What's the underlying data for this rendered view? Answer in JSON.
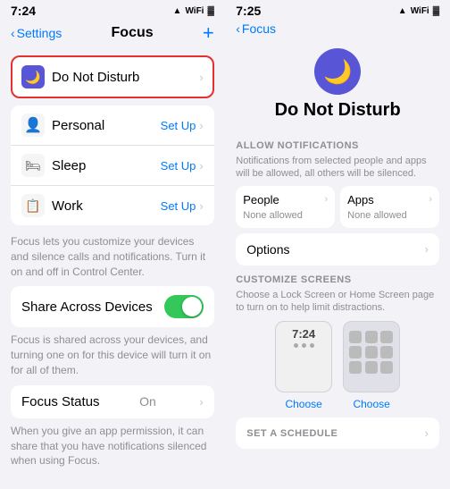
{
  "left": {
    "statusBar": {
      "time": "7:24",
      "icons": "● ▲ ▓"
    },
    "nav": {
      "back": "Settings",
      "title": "Focus",
      "add": "+"
    },
    "doNotDisturb": {
      "label": "Do Not Disturb"
    },
    "items": [
      {
        "id": "personal",
        "icon": "👤",
        "label": "Personal",
        "action": "Set Up"
      },
      {
        "id": "sleep",
        "icon": "🛏",
        "label": "Sleep",
        "action": "Set Up"
      },
      {
        "id": "work",
        "icon": "📋",
        "label": "Work",
        "action": "Set Up"
      }
    ],
    "description": "Focus lets you customize your devices and silence calls and notifications. Turn it on and off in Control Center.",
    "shareSection": {
      "label": "Share Across Devices",
      "description": "Focus is shared across your devices, and turning one on for this device will turn it on for all of them."
    },
    "focusStatus": {
      "label": "Focus Status",
      "value": "On",
      "description": "When you give an app permission, it can share that you have notifications silenced when using Focus."
    }
  },
  "right": {
    "statusBar": {
      "time": "7:25",
      "icons": "● ▲ ▓"
    },
    "nav": {
      "back": "Focus"
    },
    "header": {
      "icon": "🌙",
      "title": "Do Not Disturb"
    },
    "allowNotifications": {
      "sectionHeader": "ALLOW NOTIFICATIONS",
      "description": "Notifications from selected people and apps will be allowed, all others will be silenced.",
      "people": {
        "label": "People",
        "sub": "None allowed"
      },
      "apps": {
        "label": "Apps",
        "sub": "None allowed"
      },
      "options": {
        "label": "Options"
      }
    },
    "customizeScreens": {
      "sectionHeader": "CUSTOMIZE SCREENS",
      "description": "Choose a Lock Screen or Home Screen page to turn on to help limit distractions.",
      "lockScreen": {
        "time": "7:24",
        "choose": "Choose"
      },
      "homeScreen": {
        "choose": "Choose"
      }
    },
    "setSchedule": {
      "label": "SET A SCHEDULE"
    }
  }
}
